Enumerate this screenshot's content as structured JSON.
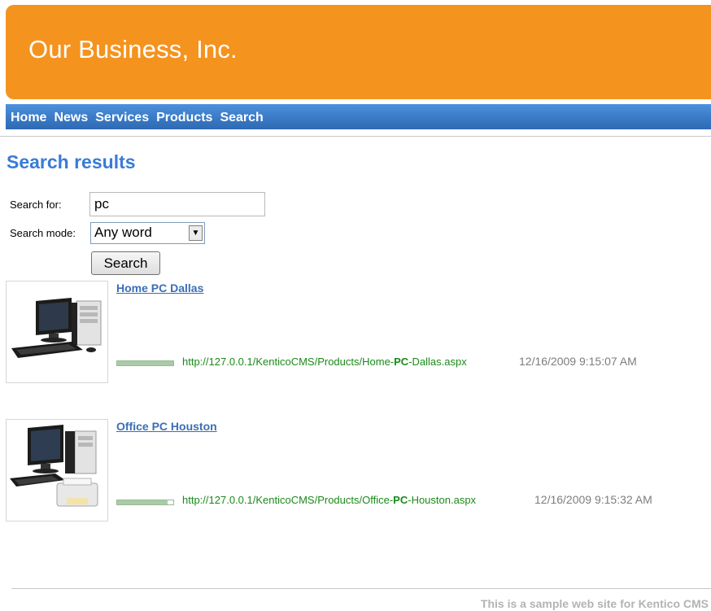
{
  "header": {
    "site_title": "Our Business, Inc."
  },
  "nav": {
    "items": [
      "Home",
      "News",
      "Services",
      "Products",
      "Search"
    ]
  },
  "page_title": "Search results",
  "form": {
    "search_for_label": "Search for:",
    "search_value": "pc",
    "search_mode_label": "Search mode:",
    "search_mode_value": "Any word",
    "search_button": "Search"
  },
  "results": [
    {
      "title": "Home PC Dallas",
      "url_prefix": "http://127.0.0.1/KenticoCMS/Products/Home-",
      "url_match": "PC",
      "url_suffix": "-Dallas.aspx",
      "date": "12/16/2009 9:15:07 AM",
      "score": 1.0
    },
    {
      "title": "Office PC Houston",
      "url_prefix": "http://127.0.0.1/KenticoCMS/Products/Office-",
      "url_match": "PC",
      "url_suffix": "-Houston.aspx",
      "date": "12/16/2009 9:15:32 AM",
      "score": 0.9
    }
  ],
  "footer": {
    "text": "This is a sample web site for Kentico CMS"
  },
  "colors": {
    "header": "#f5931f",
    "nav": "#3a7ac6",
    "title": "#3a7bd5",
    "url": "#1a8a1a"
  }
}
